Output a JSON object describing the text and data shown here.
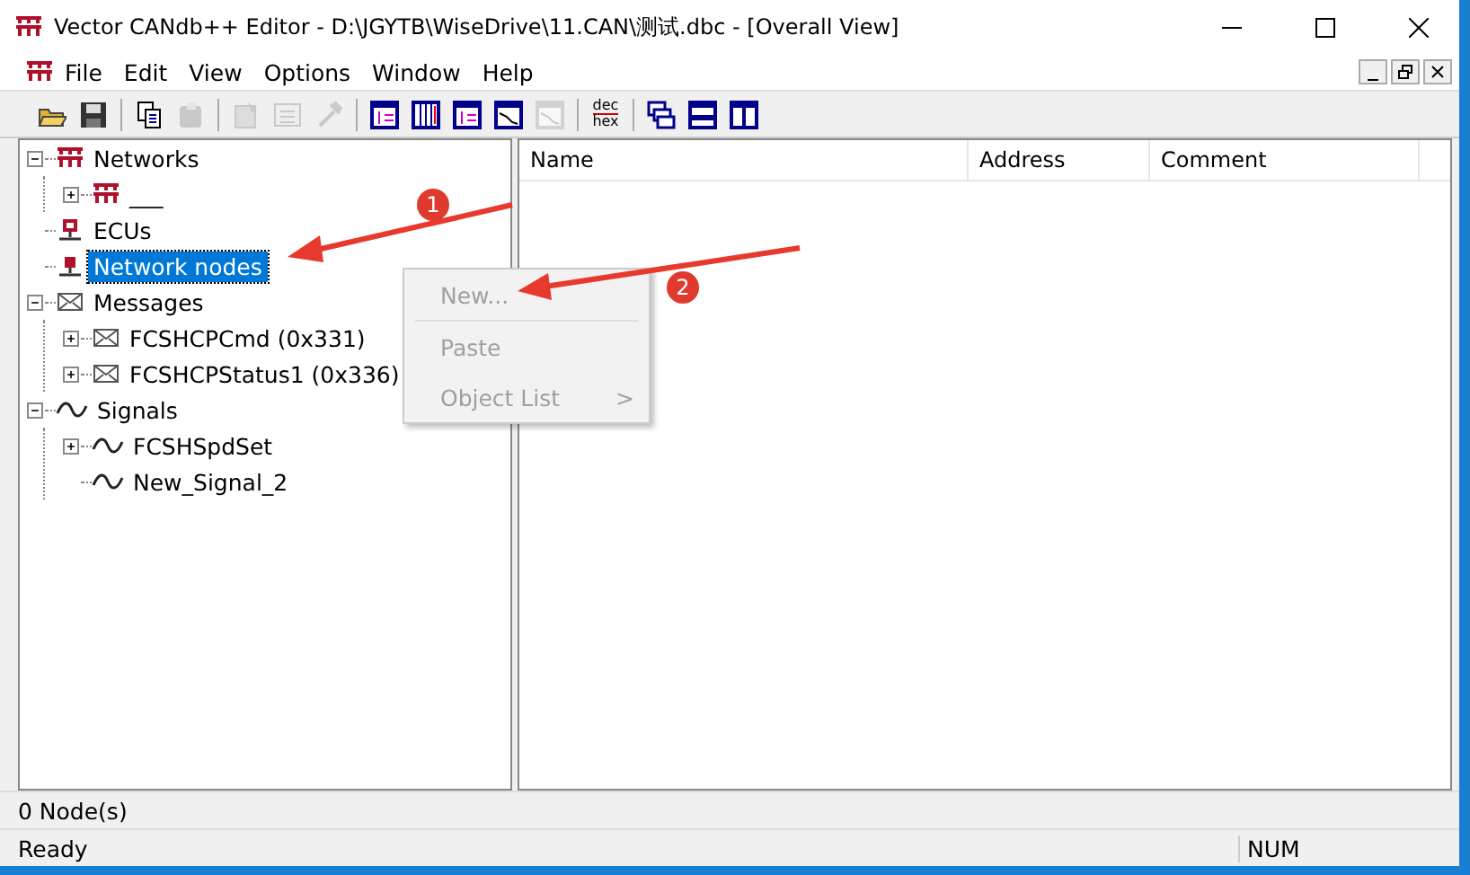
{
  "window": {
    "title": "Vector CANdb++ Editor - D:\\JGYTB\\WiseDrive\\11.CAN\\测试.dbc - [Overall View]"
  },
  "menu": [
    "File",
    "Edit",
    "View",
    "Options",
    "Window",
    "Help"
  ],
  "toolbar": [
    {
      "kind": "open",
      "disabled": false
    },
    {
      "kind": "save",
      "disabled": false
    },
    {
      "kind": "separator"
    },
    {
      "kind": "copy",
      "disabled": false
    },
    {
      "kind": "paste",
      "disabled": true
    },
    {
      "kind": "separator"
    },
    {
      "kind": "properties",
      "disabled": true
    },
    {
      "kind": "list",
      "disabled": true
    },
    {
      "kind": "tool",
      "disabled": true
    },
    {
      "kind": "separator"
    },
    {
      "kind": "view",
      "disabled": false
    },
    {
      "kind": "columns",
      "disabled": false
    },
    {
      "kind": "view",
      "disabled": false
    },
    {
      "kind": "chart",
      "disabled": false
    },
    {
      "kind": "chart",
      "disabled": true
    },
    {
      "kind": "separator"
    },
    {
      "kind": "dechex",
      "disabled": false,
      "top": "dec",
      "bottom": "hex"
    },
    {
      "kind": "separator"
    },
    {
      "kind": "cascade",
      "disabled": false
    },
    {
      "kind": "tile-horizontal",
      "disabled": false
    },
    {
      "kind": "tile-vertical",
      "disabled": false
    }
  ],
  "tree": [
    {
      "label": "Networks",
      "kind": "network",
      "expanded": true,
      "selected": false,
      "children": [
        {
          "label": "___",
          "kind": "network",
          "expanded": false,
          "selected": false
        }
      ]
    },
    {
      "label": "ECUs",
      "kind": "ecu",
      "selected": false
    },
    {
      "label": "Network nodes",
      "kind": "node",
      "selected": true
    },
    {
      "label": "Messages",
      "kind": "message",
      "expanded": true,
      "selected": false,
      "children": [
        {
          "label": "FCSHCPCmd (0x331)",
          "kind": "message",
          "expanded": false,
          "selected": false
        },
        {
          "label": "FCSHCPStatus1 (0x336)",
          "kind": "message",
          "expanded": false,
          "selected": false
        }
      ]
    },
    {
      "label": "Signals",
      "kind": "signal",
      "expanded": true,
      "selected": false,
      "children": [
        {
          "label": "FCSHSpdSet",
          "kind": "signal",
          "expanded": false,
          "selected": false
        },
        {
          "label": "New_Signal_2",
          "kind": "signal",
          "selected": false
        }
      ]
    }
  ],
  "context_menu": [
    {
      "label": "New...",
      "disabled": true
    },
    {
      "label": "Paste",
      "disabled": true
    },
    {
      "label": "Object List",
      "disabled": true,
      "arrow": ">"
    }
  ],
  "table": {
    "columns": [
      "Name",
      "Address",
      "Comment"
    ]
  },
  "annotations": [
    {
      "label": "1"
    },
    {
      "label": "2"
    }
  ],
  "status": {
    "count": "0 Node(s)",
    "message": "Ready",
    "indicator": "NUM"
  }
}
